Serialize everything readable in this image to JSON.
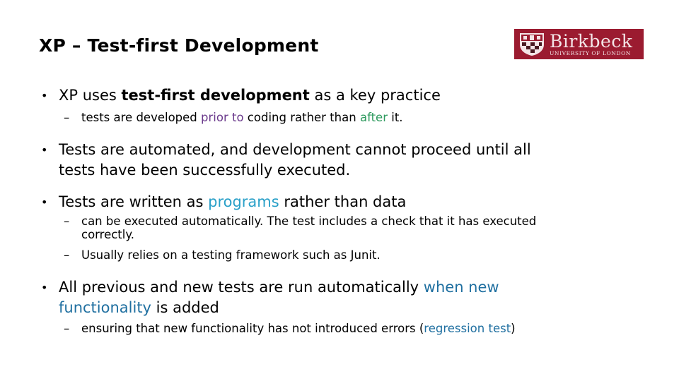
{
  "slide": {
    "title": "XP – Test-first Development",
    "logo": {
      "name": "Birkbeck",
      "subtitle": "UNIVERSITY OF LONDON",
      "background": "#9b1b30"
    },
    "colors": {
      "purple": "#6b3a8c",
      "green": "#2e9a5e",
      "cyan": "#2aa0c8",
      "blue": "#1f6fa0"
    },
    "bullets": [
      {
        "parts": [
          "XP uses ",
          "test-first development",
          " as a key practice"
        ],
        "sub": [
          {
            "parts": [
              "tests are developed ",
              "prior to",
              " coding rather than ",
              "after",
              " it."
            ]
          }
        ]
      },
      {
        "line1": "Tests are automated, and development cannot proceed until all",
        "line2": "tests have been successfully executed."
      },
      {
        "parts": [
          "Tests are written as ",
          "programs",
          " rather than data"
        ],
        "sub": [
          {
            "line1": "can be executed automatically. The test includes a check that it has executed",
            "line2": "correctly."
          },
          {
            "text": "Usually relies on a testing framework such as Junit."
          }
        ]
      },
      {
        "line1_parts": [
          "All previous and new tests are run automatically ",
          "when new"
        ],
        "line2_parts": [
          "functionality",
          " is added"
        ],
        "sub": [
          {
            "parts": [
              "ensuring that new functionality has not introduced errors (",
              "regression test",
              ")"
            ]
          }
        ]
      }
    ],
    "bullet_glyph": "•",
    "dash_glyph": "–"
  }
}
